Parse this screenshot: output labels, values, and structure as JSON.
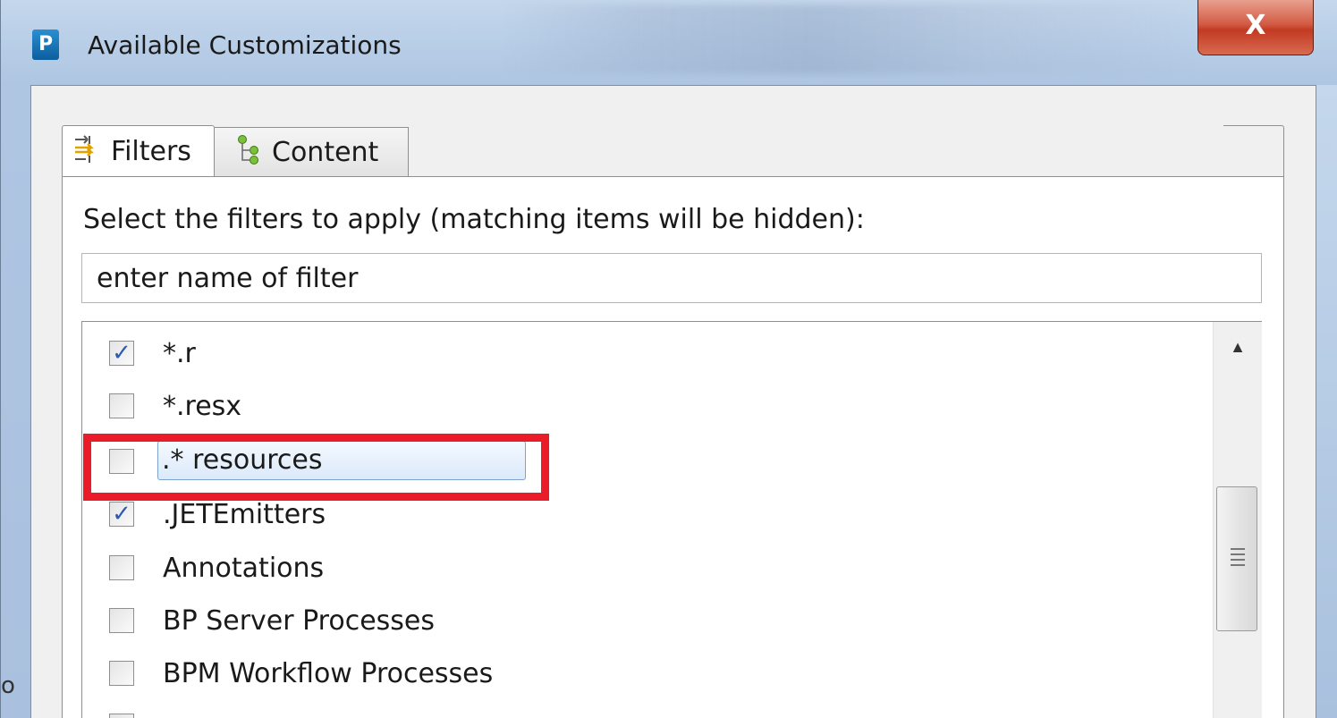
{
  "window": {
    "app_icon_letter": "P",
    "title": "Available Customizations",
    "close_glyph": "X"
  },
  "tabs": [
    {
      "label": "Filters",
      "icon": "filters-icon",
      "active": true
    },
    {
      "label": "Content",
      "icon": "content-tree-icon",
      "active": false
    }
  ],
  "filters_panel": {
    "prompt": "Select the filters to apply (matching items will be hidden):",
    "search_value": "enter name of filter"
  },
  "filter_items": [
    {
      "label": "*.r",
      "checked": true
    },
    {
      "label": "*.resx",
      "checked": false
    },
    {
      "label": ".* resources",
      "checked": false,
      "selected": true
    },
    {
      "label": ".JETEmitters",
      "checked": true
    },
    {
      "label": "Annotations",
      "checked": false
    },
    {
      "label": "BP Server Processes",
      "checked": false
    },
    {
      "label": "BPM Workflow Processes",
      "checked": false
    }
  ],
  "left_edge_fragment": "o",
  "colors": {
    "highlight": "#ea1c2a",
    "close_button": "#c23a22",
    "check": "#2a5bb7",
    "selection": "#dbe9fa"
  }
}
